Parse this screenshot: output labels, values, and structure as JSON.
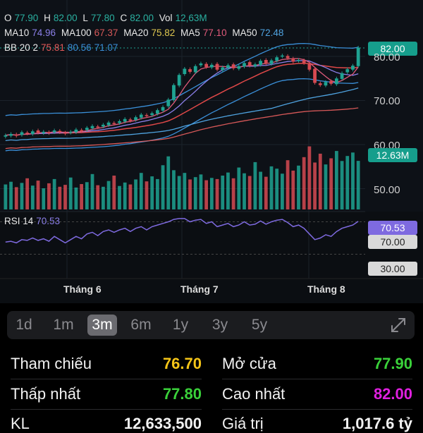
{
  "ohlc": {
    "o_label": "O",
    "o": "77.90",
    "h_label": "H",
    "h": "82.00",
    "l_label": "L",
    "l": "77.80",
    "c_label": "C",
    "c": "82.00",
    "vol_label": "Vol",
    "vol": "12,63M"
  },
  "ma": {
    "ma10_label": "MA10",
    "ma10": "74.96",
    "ma100_label": "MA100",
    "ma100": "67.37",
    "ma20_label": "MA20",
    "ma20": "75.82",
    "ma5_label": "MA5",
    "ma5": "77.10",
    "ma50_label": "MA50",
    "ma50": "72.48"
  },
  "bb": {
    "label": "BB 20 2",
    "upper": "75.81",
    "mid": "80.56",
    "lower": "71.07"
  },
  "rsi": {
    "label": "RSI 14",
    "value": "70.53",
    "level_high": "70.00",
    "level_low": "30.00"
  },
  "price_axis": {
    "current_price": "82.00",
    "tick_80": "80.00",
    "tick_70": "70.00",
    "tick_60": "60.00",
    "tick_50": "50.00",
    "volume_tag": "12.63M"
  },
  "months": [
    "Tháng 6",
    "Tháng 7",
    "Tháng 8"
  ],
  "ranges": [
    "1d",
    "1m",
    "3m",
    "6m",
    "1y",
    "3y",
    "5y"
  ],
  "active_range": "3m",
  "stats": {
    "ref_label": "Tham chiếu",
    "ref_value": "76.70",
    "open_label": "Mở cửa",
    "open_value": "77.90",
    "low_label": "Thấp nhất",
    "low_value": "77.80",
    "high_label": "Cao nhất",
    "high_value": "82.00",
    "vol_label": "KL",
    "vol_value": "12,633,500",
    "val_label": "Giá trị",
    "val_value": "1,017.6 tỷ"
  },
  "colors": {
    "up": "#1fa392",
    "down": "#d64a52",
    "ma10": "#8b7fe8",
    "ma100": "#d65858",
    "ma20": "#e0c850",
    "ma5": "#e05a7a",
    "ma50": "#4fa3e0",
    "rsi": "#7e6ae0",
    "ref": "#f5c518",
    "green": "#3ad13a",
    "magenta": "#e020e0"
  },
  "chart_data": {
    "type": "candlestick",
    "ylim": [
      45,
      85
    ],
    "closes": [
      62.1,
      62.4,
      62.0,
      62.8,
      62.5,
      63.0,
      62.7,
      62.9,
      62.6,
      63.2,
      62.8,
      62.5,
      62.9,
      63.4,
      63.1,
      63.8,
      64.2,
      63.9,
      64.5,
      65.0,
      64.7,
      65.3,
      65.8,
      65.4,
      66.2,
      66.8,
      66.5,
      67.1,
      67.8,
      68.5,
      70.2,
      73.5,
      75.8,
      77.2,
      76.5,
      77.8,
      78.4,
      77.6,
      78.1,
      77.0,
      77.5,
      78.0,
      77.3,
      77.8,
      78.5,
      77.9,
      78.2,
      79.0,
      78.4,
      79.1,
      79.8,
      80.2,
      79.6,
      78.8,
      79.2,
      78.5,
      77.0,
      74.0,
      73.5,
      74.2,
      73.8,
      75.0,
      76.2,
      77.1,
      77.9,
      82.0
    ],
    "volumes_m": [
      6.5,
      7.2,
      5.8,
      6.9,
      8.1,
      6.2,
      7.5,
      5.5,
      6.8,
      7.9,
      5.9,
      6.4,
      8.3,
      5.7,
      6.6,
      7.1,
      9.2,
      6.3,
      5.9,
      7.4,
      8.8,
      6.1,
      7.0,
      6.5,
      7.8,
      9.5,
      7.3,
      8.6,
      7.9,
      11.5,
      13.8,
      10.2,
      8.7,
      9.5,
      7.8,
      8.4,
      9.1,
      7.6,
      8.2,
      7.9,
      8.8,
      9.6,
      8.1,
      10.9,
      9.4,
      8.7,
      12.3,
      9.8,
      8.5,
      11.2,
      10.6,
      9.3,
      12.8,
      10.1,
      11.4,
      13.6,
      16.4,
      12.2,
      14.5,
      11.7,
      13.3,
      15.2,
      12.6,
      13.9,
      14.8,
      12.63
    ],
    "rsi": [
      45,
      46,
      44,
      48,
      47,
      50,
      47,
      49,
      46,
      52,
      48,
      44,
      48,
      52,
      49,
      55,
      57,
      53,
      58,
      60,
      57,
      60,
      62,
      58,
      62,
      64,
      60,
      64,
      66,
      68,
      70,
      73,
      74,
      74,
      70,
      72,
      73,
      68,
      70,
      64,
      66,
      68,
      64,
      66,
      70,
      66,
      67,
      71,
      67,
      70,
      72,
      73,
      69,
      64,
      66,
      62,
      55,
      48,
      50,
      54,
      52,
      58,
      62,
      64,
      66,
      70.53
    ]
  }
}
